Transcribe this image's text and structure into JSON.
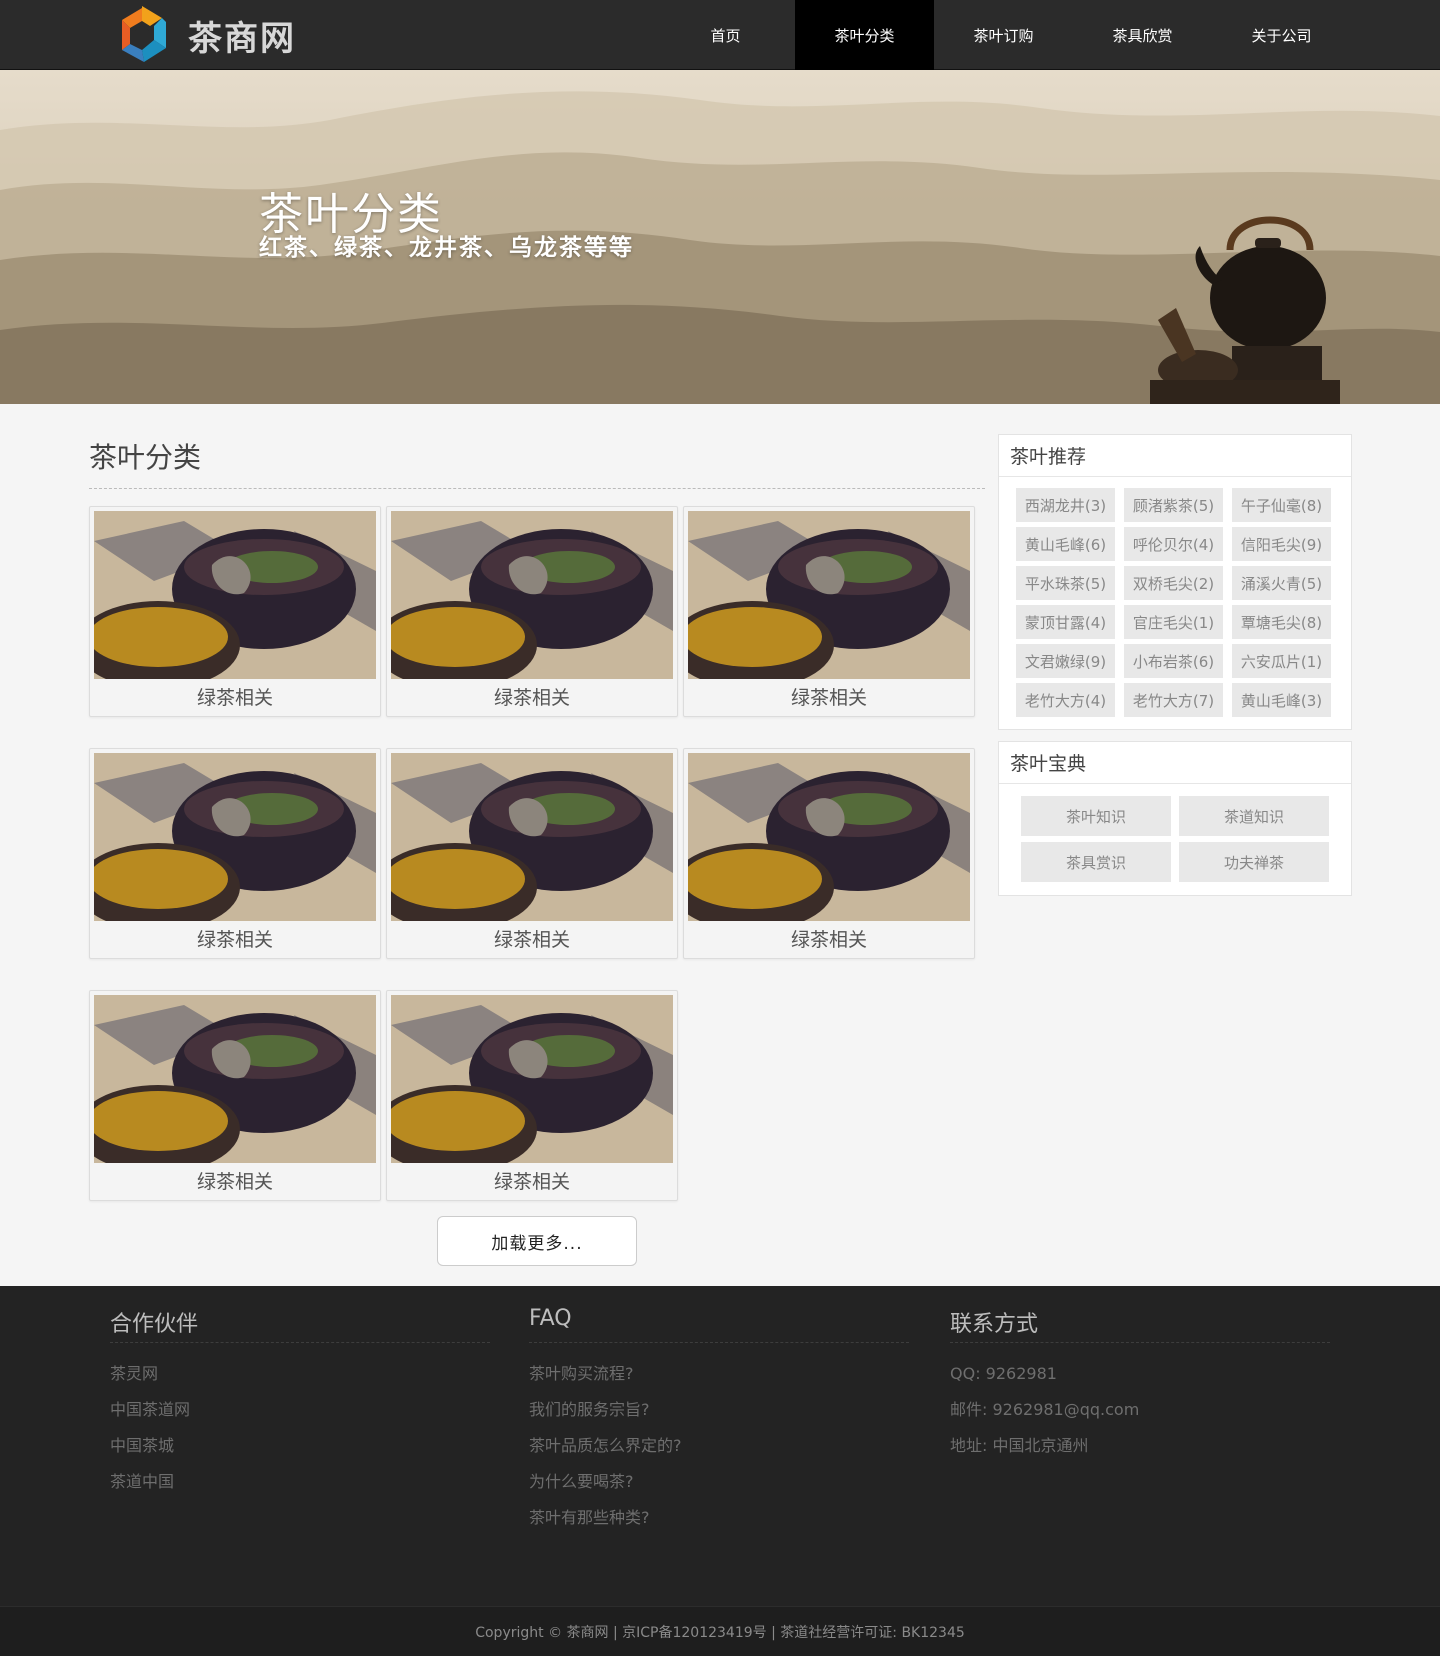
{
  "header": {
    "logo_text": "茶商网",
    "nav": [
      {
        "label": "首页",
        "active": false
      },
      {
        "label": "茶叶分类",
        "active": true
      },
      {
        "label": "茶叶订购",
        "active": false
      },
      {
        "label": "茶具欣赏",
        "active": false
      },
      {
        "label": "关于公司",
        "active": false
      }
    ]
  },
  "banner": {
    "title": "茶叶分类",
    "subtitle": "红茶、绿茶、龙井茶、乌龙茶等等"
  },
  "main": {
    "title": "茶叶分类",
    "cards": [
      {
        "label": "绿茶相关"
      },
      {
        "label": "绿茶相关"
      },
      {
        "label": "绿茶相关"
      },
      {
        "label": "绿茶相关"
      },
      {
        "label": "绿茶相关"
      },
      {
        "label": "绿茶相关"
      },
      {
        "label": "绿茶相关"
      },
      {
        "label": "绿茶相关"
      }
    ],
    "load_more": "加载更多..."
  },
  "sidebar": {
    "recommend_title": "茶叶推荐",
    "tags": [
      "西湖龙井(3)",
      "顾渚紫茶(5)",
      "午子仙毫(8)",
      "黄山毛峰(6)",
      "呼伦贝尔(4)",
      "信阳毛尖(9)",
      "平水珠茶(5)",
      "双桥毛尖(2)",
      "涌溪火青(5)",
      "蒙顶甘露(4)",
      "官庄毛尖(1)",
      "覃塘毛尖(8)",
      "文君嫩绿(9)",
      "小布岩茶(6)",
      "六安瓜片(1)",
      "老竹大方(4)",
      "老竹大方(7)",
      "黄山毛峰(3)"
    ],
    "book_title": "茶叶宝典",
    "books": [
      "茶叶知识",
      "茶道知识",
      "茶具赏识",
      "功夫禅茶"
    ]
  },
  "footer": {
    "partners_title": "合作伙伴",
    "partners": [
      "茶灵网",
      "中国茶道网",
      "中国茶城",
      "茶道中国"
    ],
    "faq_title": "FAQ",
    "faq": [
      "茶叶购买流程?",
      "我们的服务宗旨?",
      "茶叶品质怎么界定的?",
      "为什么要喝茶?",
      "茶叶有那些种类?"
    ],
    "contact_title": "联系方式",
    "contact": [
      "QQ: 9262981",
      "邮件: 9262981@qq.com",
      "地址: 中国北京通州"
    ],
    "copyright": "Copyright © 茶商网 | 京ICP备120123419号 | 茶道社经营许可证: BK12345"
  },
  "colors": {
    "header_bg": "#2b2b2b",
    "nav_active_bg": "#000000",
    "page_bg": "#f5f5f5",
    "footer_bg": "#232323",
    "tag_bg": "#e8e8e8"
  }
}
